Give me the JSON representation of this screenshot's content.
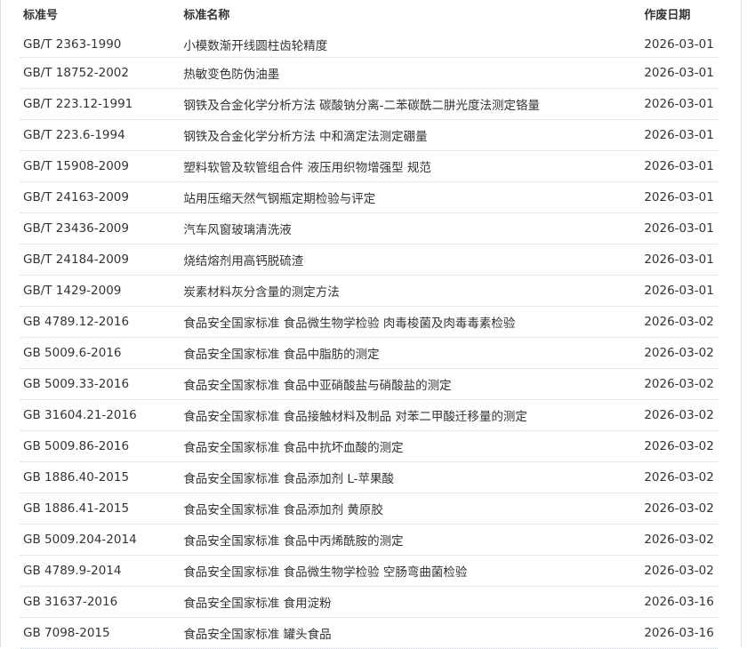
{
  "table": {
    "headers": {
      "code": "标准号",
      "name": "标准名称",
      "date": "作废日期"
    },
    "rows": [
      {
        "code": "GB/T 2363-1990",
        "name": "小模数渐开线圆柱齿轮精度",
        "date": "2026-03-01"
      },
      {
        "code": "GB/T 18752-2002",
        "name": "热敏变色防伪油墨",
        "date": "2026-03-01"
      },
      {
        "code": "GB/T 223.12-1991",
        "name": "钢铁及合金化学分析方法 碳酸钠分离-二苯碳酰二肼光度法测定铬量",
        "date": "2026-03-01"
      },
      {
        "code": "GB/T 223.6-1994",
        "name": "钢铁及合金化学分析方法 中和滴定法测定硼量",
        "date": "2026-03-01"
      },
      {
        "code": "GB/T 15908-2009",
        "name": "塑料软管及软管组合件 液压用织物增强型 规范",
        "date": "2026-03-01"
      },
      {
        "code": "GB/T 24163-2009",
        "name": "站用压缩天然气钢瓶定期检验与评定",
        "date": "2026-03-01"
      },
      {
        "code": "GB/T 23436-2009",
        "name": "汽车风窗玻璃清洗液",
        "date": "2026-03-01"
      },
      {
        "code": "GB/T 24184-2009",
        "name": "烧结熔剂用高钙脱硫渣",
        "date": "2026-03-01"
      },
      {
        "code": "GB/T 1429-2009",
        "name": "炭素材料灰分含量的测定方法",
        "date": "2026-03-01"
      },
      {
        "code": "GB 4789.12-2016",
        "name": "食品安全国家标准 食品微生物学检验 肉毒梭菌及肉毒毒素检验",
        "date": "2026-03-02"
      },
      {
        "code": "GB 5009.6-2016",
        "name": "食品安全国家标准 食品中脂肪的测定",
        "date": "2026-03-02"
      },
      {
        "code": "GB 5009.33-2016",
        "name": "食品安全国家标准 食品中亚硝酸盐与硝酸盐的测定",
        "date": "2026-03-02"
      },
      {
        "code": "GB 31604.21-2016",
        "name": "食品安全国家标准 食品接触材料及制品 对苯二甲酸迁移量的测定",
        "date": "2026-03-02"
      },
      {
        "code": "GB 5009.86-2016",
        "name": "食品安全国家标准 食品中抗坏血酸的测定",
        "date": "2026-03-02"
      },
      {
        "code": "GB 1886.40-2015",
        "name": "食品安全国家标准 食品添加剂 L-苹果酸",
        "date": "2026-03-02"
      },
      {
        "code": "GB 1886.41-2015",
        "name": "食品安全国家标准 食品添加剂 黄原胶",
        "date": "2026-03-02"
      },
      {
        "code": "GB 5009.204-2014",
        "name": "食品安全国家标准 食品中丙烯酰胺的测定",
        "date": "2026-03-02"
      },
      {
        "code": "GB 4789.9-2014",
        "name": "食品安全国家标准 食品微生物学检验 空肠弯曲菌检验",
        "date": "2026-03-02"
      },
      {
        "code": "GB 31637-2016",
        "name": "食品安全国家标准 食用淀粉",
        "date": "2026-03-16"
      },
      {
        "code": "GB 7098-2015",
        "name": "食品安全国家标准 罐头食品",
        "date": "2026-03-16"
      }
    ]
  }
}
